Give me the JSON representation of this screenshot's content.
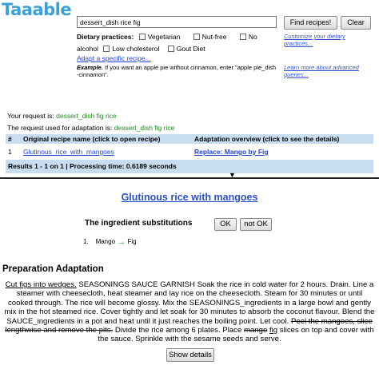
{
  "header": {
    "logo": "Taaable",
    "search_value": "dessert_dish rice fig",
    "find_label": "Find recipes!",
    "clear_label": "Clear"
  },
  "diet": {
    "label": "Dietary practices:",
    "options": [
      "Vegetarian",
      "Nut-free",
      "No",
      "alcohol",
      "Low cholesterol",
      "Gout Diet"
    ],
    "adapt_link": "Adapt a specific recipe...",
    "example_bold": "Example.",
    "example_text": "If you want an apple pie without cinnamon, enter \"apple pie_dish -cinnamon\".",
    "customize_link": "Customize your dietary practices...",
    "learn_link": "Learn more about advanced queries..."
  },
  "request": {
    "label1": "Your request is:",
    "value1": "dessert_dish fig rice",
    "label2": "The request used for adaptation is:",
    "value2": "dessert_dish fig rice"
  },
  "table": {
    "headers": [
      "#",
      "Original recipe name (click to open recipe)",
      "Adaptation overview (click to see the details)"
    ],
    "rows": [
      {
        "num": "1",
        "recipe": "Glutinous_rice_with_mangoes",
        "adaptation": "Replace: Mango by Fig"
      }
    ],
    "results": "Results 1 - 1 on 1 | Processing time: 0.6189 seconds"
  },
  "detail": {
    "title": "Glutinous rice with mangoes",
    "subs_label": "The ingredient substitutions",
    "ok_label": "OK",
    "notok_label": "not OK",
    "sub_num": "1.",
    "sub_from": "Mango",
    "sub_arrow": "→",
    "sub_to": "Fig",
    "prep_title": "Preparation Adaptation",
    "prep_underlined": "Cut figs into wedges.",
    "prep_part1": " SEASONINGS SAUCE GARNISH Soak the rice in cold water for 2 hours. Drain. Line a steamer with cheesecloth, heat steamer and lay rice on the cheesecloth. Steam for 30 minutes or until cooked through. The rice will become glossy. Mix the SEASONINGS_ingredients in a large bowl and gently mix in the hot steamed rice. Cover tightly and let soak for 30 minutes to absorb the coconut flavour. Blend the SAUCE_ingredients in a pot and heat until it just reaches the boiling point. Let cool. ",
    "prep_struck1": "Peel the mangoes, slice lengthwise and remove the pits.",
    "prep_part2": " Divide the rice among 6 plates. Place ",
    "prep_struck2": "mango",
    "prep_part3": " ",
    "prep_underlined2": "fig",
    "prep_part4": " slices on top and cover with the sauce. Sprinkle with the sesame seeds and serve.",
    "show_details": "Show details"
  },
  "colors": {
    "logo": "#3aa0d8",
    "table_bg": "#c9ddf1",
    "link": "#2244cc",
    "green": "#228822"
  }
}
